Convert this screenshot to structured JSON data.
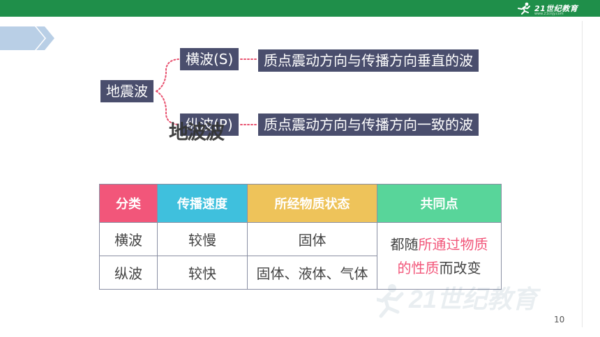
{
  "header": {
    "logo_text": "21世纪教育",
    "logo_url": "www.21cnjy.com"
  },
  "mindmap": {
    "root": "地震波",
    "branches": [
      {
        "label": "横波(S)",
        "description": "质点震动方向与传播方向垂直的波"
      },
      {
        "label": "纵波(P)",
        "description": "质点震动方向与传播方向一致的波"
      }
    ],
    "overlay_text": "地波波"
  },
  "table": {
    "headers": [
      "分类",
      "传播速度",
      "所经物质状态",
      "共同点"
    ],
    "rows": [
      [
        "横波",
        "较慢",
        "固体"
      ],
      [
        "纵波",
        "较快",
        "固体、液体、气体"
      ]
    ],
    "common": {
      "prefix": "都随",
      "highlight_1": "所通过物质",
      "highlight_2": "的性质",
      "suffix": "而改变"
    }
  },
  "watermark_text": "21世纪教育",
  "page_number": "10",
  "colors": {
    "topbar": "#1f8f4a",
    "tag_bg": "#4a4e6d",
    "header_red": "#f2567a",
    "header_blue": "#3fc0dd",
    "header_yellow": "#eec35a",
    "header_green": "#58d59a",
    "connector": "#e8506e"
  }
}
